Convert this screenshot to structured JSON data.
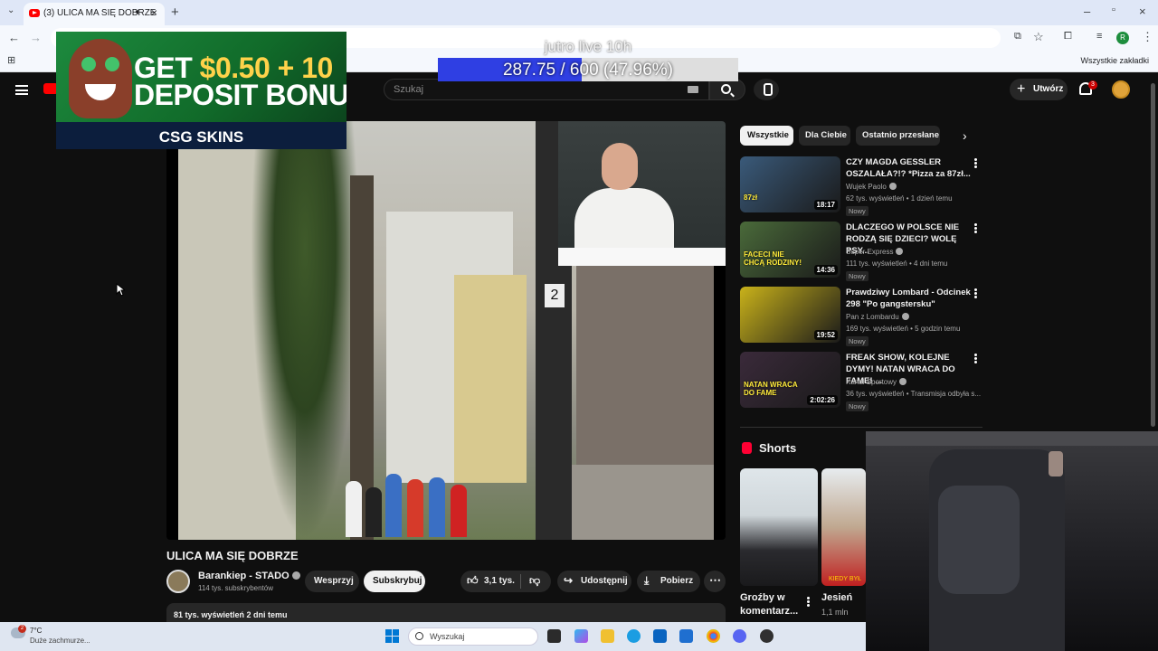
{
  "browser": {
    "tab_title": "(3) ULICA MA SIĘ DOBRZE",
    "bookmarks_label": "Wszystkie zakładki",
    "profile_initial": "R"
  },
  "youtube": {
    "search_placeholder": "Szukaj",
    "create_label": "Utwórz",
    "notifications_count": "3"
  },
  "overlay": {
    "ad_line1_prefix": "GET",
    "ad_line1_amount": "$0.50 + 10",
    "ad_line2": "DEPOSIT BONU",
    "ad_brand": "CSG SKINS",
    "donation_title": "jutro live 10h",
    "donation_text": "287.75 / 600 (47.96%)",
    "donation_progress": 0.4796
  },
  "video": {
    "title": "ULICA MA SIĘ DOBRZE",
    "channel": "Barankiep - STADO",
    "subscribers": "114 tys. subskrybentów",
    "support_label": "Wesprzyj",
    "subscribe_label": "Subskrybuj",
    "likes": "3,1 tys.",
    "share_label": "Udostępnij",
    "download_label": "Pobierz",
    "views_date": "81 tys. wyświetleń  2 dni temu",
    "inset_sign": "2"
  },
  "chips": [
    "Wszystkie",
    "Dla Ciebie",
    "Ostatnio przesłane"
  ],
  "recommendations": [
    {
      "title": "CZY MAGDA GESSLER OSZALAŁA?!? *Pizza za 87zł...",
      "channel": "Wujek Paolo",
      "meta": "62 tys. wyświetleń • 1 dzień temu",
      "badge": "Nowy",
      "duration": "18:17",
      "thumb_text": "87zł",
      "thumb_color": "#3a5a7a"
    },
    {
      "title": "DLACZEGO W POLSCE NIE RODZĄ SIĘ DZIECI? WOLĘ PSY...",
      "channel": "Super Express",
      "meta": "111 tys. wyświetleń • 4 dni temu",
      "badge": "Nowy",
      "duration": "14:36",
      "thumb_text": "FACECI NIE CHCĄ RODZINY!",
      "thumb_color": "#4a6a3a"
    },
    {
      "title": "Prawdziwy Lombard - Odcinek 298 \"Po gangstersku\"",
      "channel": "Pan z Lombardu",
      "meta": "169 tys. wyświetleń • 5 godzin temu",
      "badge": "Nowy",
      "duration": "19:52",
      "thumb_text": "",
      "thumb_color": "#c9b21a"
    },
    {
      "title": "FREAK SHOW, KOLEJNE DYMY! NATAN WRACA DO FAME! ...",
      "channel": "Kanał Sportowy",
      "meta": "36 tys. wyświetleń • Transmisja odbyła s...",
      "badge": "Nowy",
      "duration": "2:02:26",
      "thumb_text": "NATAN WRACA DO FAME",
      "thumb_color": "#3a2a3a"
    }
  ],
  "shorts": {
    "label": "Shorts",
    "items": [
      {
        "title": "Groźby w komentarz...",
        "meta": ""
      },
      {
        "title": "Jesień",
        "meta": "1,1 mln",
        "overlay": "KIEDY BYŁ"
      }
    ]
  },
  "taskbar": {
    "temperature": "7°C",
    "weather": "Duże zachmurze...",
    "weather_badge": "2",
    "search_placeholder": "Wyszukaj"
  }
}
